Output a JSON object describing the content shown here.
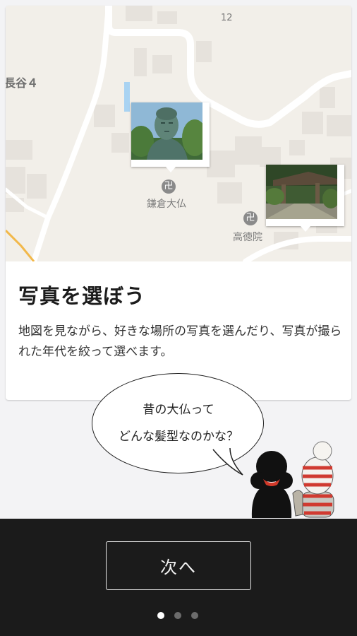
{
  "map": {
    "road_number": "12",
    "area_label": "長谷４",
    "places": [
      {
        "name": "鎌倉大仏",
        "icon": "temple-icon"
      },
      {
        "name": "高徳院",
        "icon": "temple-icon"
      }
    ],
    "photo_pins": [
      {
        "subject": "great-buddha-photo"
      },
      {
        "subject": "temple-garden-photo"
      }
    ],
    "colors": {
      "land": "#f2efe9",
      "road": "#ffffff",
      "building": "#e6e2dc",
      "water": "#a9d3f2"
    }
  },
  "card": {
    "title": "写真を選ぼう",
    "description": "地図を見ながら、好きな場所の写真を選んだり、写真が撮られた年代を絞って選べます。"
  },
  "speech_bubble": {
    "line1": "昔の大仏って",
    "line2": "どんな髪型なのかな？"
  },
  "footer": {
    "next_label": "次へ",
    "page_indicator": {
      "total": 3,
      "current": 1
    }
  }
}
